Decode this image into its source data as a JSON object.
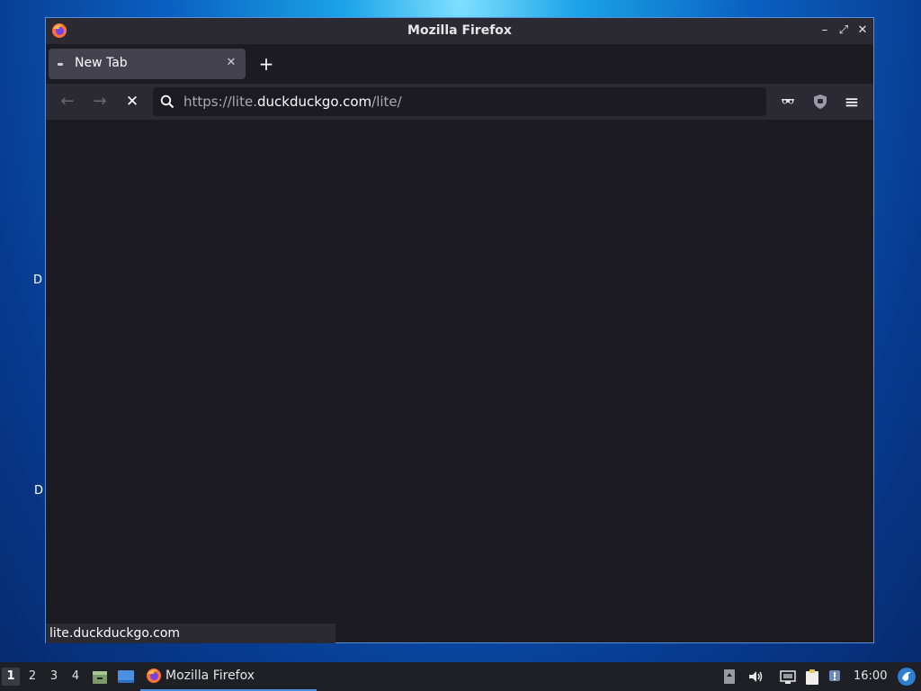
{
  "desktop": {
    "labels": [
      "D",
      "D"
    ]
  },
  "window": {
    "title": "Mozilla Firefox",
    "minimize_symbol": "–",
    "maximize_symbol": "⤢",
    "close_symbol": "✕"
  },
  "tabs": [
    {
      "label": "New Tab",
      "active": true
    }
  ],
  "newtab_symbol": "+",
  "navbar": {
    "back_symbol": "←",
    "forward_symbol": "→",
    "stop_symbol": "✕",
    "url_prefix": "https://lite.",
    "url_domain": "duckduckgo.com",
    "url_suffix": "/lite/",
    "menu_symbol": "≡"
  },
  "status": {
    "link_preview": "lite.duckduckgo.com"
  },
  "taskbar": {
    "workspaces": [
      "1",
      "2",
      "3",
      "4"
    ],
    "active_workspace": "1",
    "app_label": "Mozilla Firefox",
    "clock": "16:00"
  },
  "colors": {
    "accent": "#4a8fe0",
    "window_bg": "#1c1b22",
    "toolbar_bg": "#2b2a33"
  }
}
